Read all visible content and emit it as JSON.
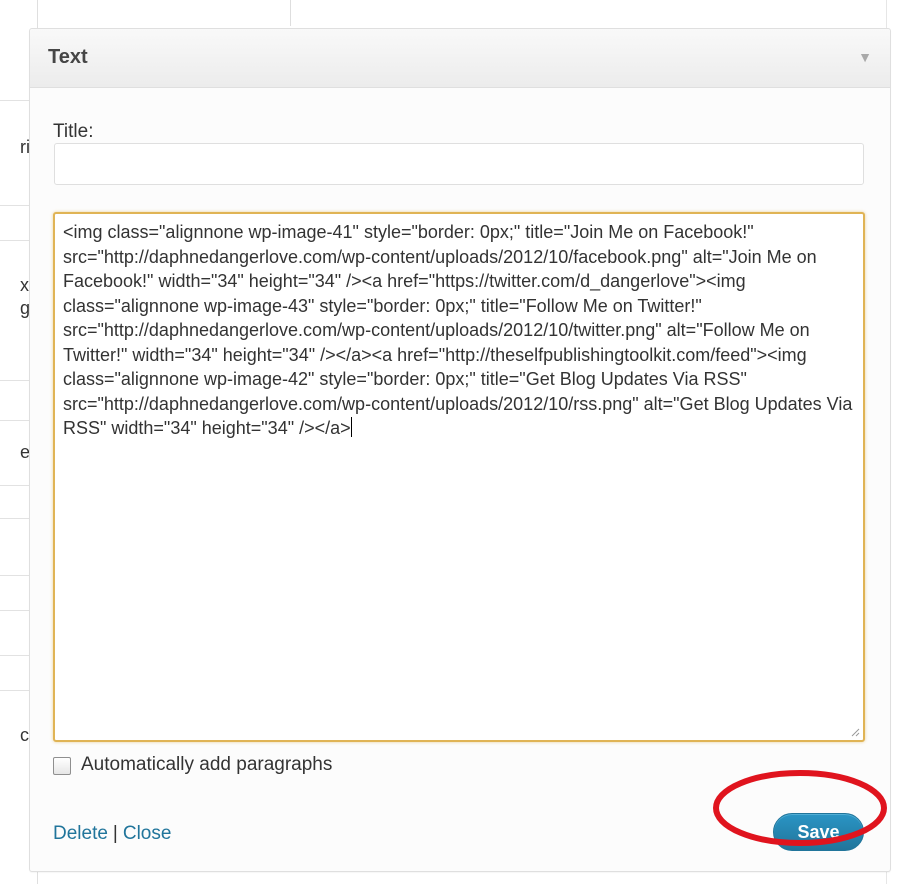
{
  "background": {
    "row_fragments": [
      "ri",
      "x",
      "g",
      "es",
      "c"
    ]
  },
  "widget": {
    "title": "Text",
    "toggle_icon": "triangle-down-icon",
    "title_label": "Title:",
    "title_value": "",
    "textarea_content": "<img class=\"alignnone  wp-image-41\" style=\"border: 0px;\" title=\"Join Me on Facebook!\" src=\"http://daphnedangerlove.com/wp-content/uploads/2012/10/facebook.png\" alt=\"Join Me on Facebook!\" width=\"34\" height=\"34\" /><a href=\"https://twitter.com/d_dangerlove\"><img class=\"alignnone  wp-image-43\" style=\"border: 0px;\" title=\"Follow Me on Twitter!\" src=\"http://daphnedangerlove.com/wp-content/uploads/2012/10/twitter.png\" alt=\"Follow Me on Twitter!\" width=\"34\" height=\"34\" /></a><a href=\"http://theselfpublishingtoolkit.com/feed\"><img class=\"alignnone wp-image-42\" style=\"border: 0px;\" title=\"Get Blog Updates Via RSS\" src=\"http://daphnedangerlove.com/wp-content/uploads/2012/10/rss.png\" alt=\"Get Blog Updates Via RSS\" width=\"34\" height=\"34\" /></a>",
    "auto_paragraphs_label": "Automatically add paragraphs",
    "auto_paragraphs_checked": false,
    "delete_label": "Delete",
    "separator": "|",
    "close_label": "Close",
    "save_label": "Save"
  },
  "colors": {
    "link": "#21759b",
    "save_button": "#21759b",
    "textarea_focus_border": "#e0b455",
    "annotation_circle": "#e0141e"
  }
}
